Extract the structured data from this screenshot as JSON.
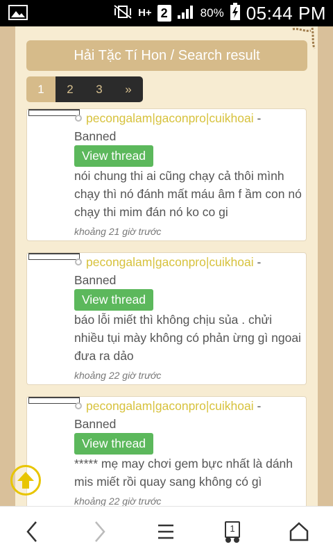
{
  "status_bar": {
    "battery_percent": "80%",
    "time": "05:44 PM",
    "sim_slot": "2",
    "network_type": "H+",
    "icons": [
      "image-icon",
      "mute-vibrate-icon",
      "network-hplus-icon",
      "sim-2-icon",
      "signal-icon",
      "battery-charging-icon"
    ]
  },
  "header": {
    "title": "Hải Tặc Tí Hon / Search result"
  },
  "pagination": {
    "pages": [
      "1",
      "2",
      "3"
    ],
    "next_label": "»",
    "current": "1"
  },
  "posts": [
    {
      "username": "pecongalam|gaconpro|cuikhoai",
      "separator": " - ",
      "status": "Banned",
      "button_label": "View thread",
      "content": "nói chung thi ai cũng chạy cả thôi mình chạy thì nó đánh mất máu âm f ầm con nó chạy thi mim đán nó ko co gi",
      "time": "khoảng 21 giờ trước"
    },
    {
      "username": "pecongalam|gaconpro|cuikhoai",
      "separator": " - ",
      "status": "Banned",
      "button_label": "View thread",
      "content": "báo lỗi miết thì không chịu sủa . chửi nhiều tụi mày không có phản ừng gì ngoai đưa ra dảo",
      "time": "khoảng 22 giờ trước"
    },
    {
      "username": "pecongalam|gaconpro|cuikhoai",
      "separator": " - ",
      "status": "Banned",
      "button_label": "View thread",
      "content": "***** mẹ may chơi gem bực nhất là dánh mis miết rồi quay sang không có gì",
      "time": "khoảng 22 giờ trước"
    }
  ],
  "bottom_nav": {
    "tab_count": "1",
    "buttons": [
      "back-icon",
      "forward-icon",
      "menu-icon",
      "tabs-icon",
      "home-icon"
    ]
  },
  "colors": {
    "username": "#d7c23d",
    "view_thread_button": "#5cb85c",
    "header_bg": "#d6bb8a",
    "page_bg": "#f7ecd2",
    "scroll_up_ring": "#e8c500"
  }
}
